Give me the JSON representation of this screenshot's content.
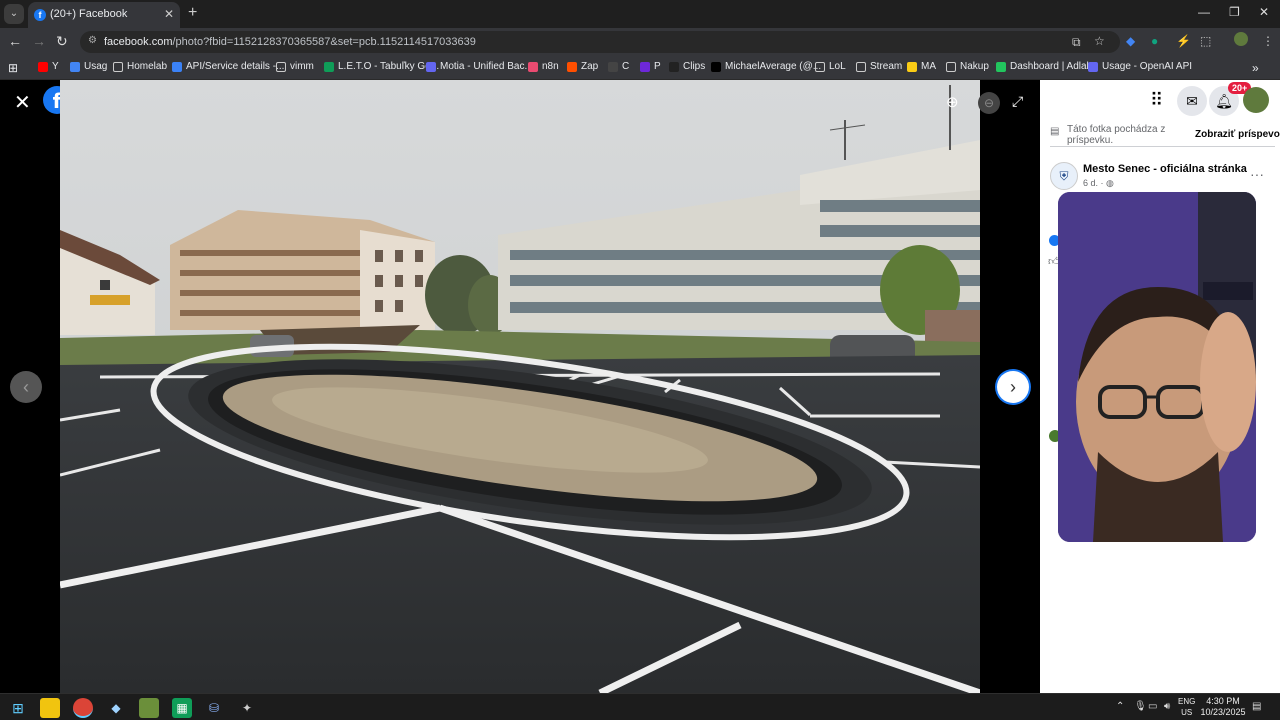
{
  "browser": {
    "tab_title": "(20+) Facebook",
    "tab_favicon": "f",
    "url_domain": "facebook.com",
    "url_path": "/photo?fbid=1152128370365587&set=pcb.1152114517033639"
  },
  "bookmarks": [
    {
      "label": "Y",
      "color": "#ff0000"
    },
    {
      "label": "Usag",
      "color": "#4285f4"
    },
    {
      "label": "Homelab",
      "color": "folder"
    },
    {
      "label": "API/Service details -...",
      "color": "#3b82f6"
    },
    {
      "label": "vimm",
      "color": "folder"
    },
    {
      "label": "L.E.T.O - Tabuľky Go...",
      "color": "#0f9d58"
    },
    {
      "label": "Motia - Unified Bac...",
      "color": "#6366f1"
    },
    {
      "label": "n8n",
      "color": "#ea4b71"
    },
    {
      "label": "Zap",
      "color": "#ff4f00"
    },
    {
      "label": "C",
      "color": "#444"
    },
    {
      "label": "P",
      "color": "#6d28d9"
    },
    {
      "label": "Clips",
      "color": "#222"
    },
    {
      "label": "MichaelAverage (@...",
      "color": "#000"
    },
    {
      "label": "LoL",
      "color": "folder"
    },
    {
      "label": "Stream",
      "color": "folder"
    },
    {
      "label": "MA",
      "color": "#facc15"
    },
    {
      "label": "Nakup",
      "color": "folder"
    },
    {
      "label": "Dashboard | Adlab",
      "color": "#22c55e"
    },
    {
      "label": "Usage - OpenAI API",
      "color": "#6366f1"
    }
  ],
  "sidebar": {
    "notif_badge": "20+",
    "info_text": "Táto fotka pochádza z príspevku.",
    "info_link": "Zobraziť príspevok",
    "page_name": "Mesto Senec - oficiálna stránka",
    "post_time": "6 d. · "
  },
  "taskbar": {
    "lang_top": "ENG",
    "lang_bottom": "US",
    "time": "4:30 PM",
    "date": "10/23/2025"
  }
}
